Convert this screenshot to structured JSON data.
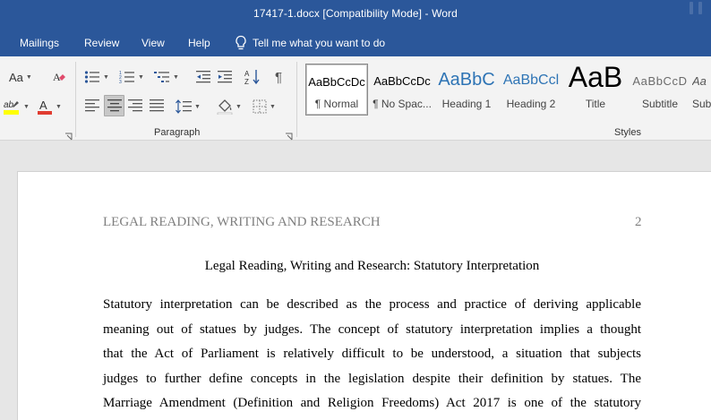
{
  "window": {
    "title": "17417-1.docx [Compatibility Mode]  -  Word"
  },
  "menu": {
    "tabs": [
      "Mailings",
      "Review",
      "View",
      "Help"
    ],
    "tell_me": "Tell me what you want to do"
  },
  "ribbon": {
    "font_group": {
      "change_case_label": "Aa"
    },
    "paragraph_group": {
      "label": "Paragraph"
    },
    "styles_group": {
      "label": "Styles",
      "items": [
        {
          "preview": "AaBbCcDc",
          "name": "¶ Normal"
        },
        {
          "preview": "AaBbCcDc",
          "name": "¶ No Spac..."
        },
        {
          "preview": "AaBbC",
          "name": "Heading 1"
        },
        {
          "preview": "AaBbCcl",
          "name": "Heading 2"
        },
        {
          "preview": "AaB",
          "name": "Title"
        },
        {
          "preview": "AaBbCcD",
          "name": "Subtitle"
        },
        {
          "preview": "Aa",
          "name": "Sub"
        }
      ]
    }
  },
  "document": {
    "header": "LEGAL READING, WRITING AND RESEARCH",
    "page_number": "2",
    "title": "Legal Reading, Writing and Research: Statutory Interpretation",
    "body_lines": [
      "Statutory interpretation can be described as the process and practice of deriving applicable",
      "meaning out of statues by judges. The concept of statutory interpretation implies a thought",
      "that the Act of Parliament is relatively difficult to be understood, a situation that subjects",
      "judges to further define concepts in the legislation despite their definition by statues. The",
      "Marriage Amendment (Definition and Religion Freedoms) Act 2017 is one of the statutory"
    ]
  },
  "colors": {
    "titlebar": "#2b579a",
    "ribbon": "#f3f3f3",
    "workspace": "#e6e6e6",
    "heading_blue": "#2e74b5"
  }
}
